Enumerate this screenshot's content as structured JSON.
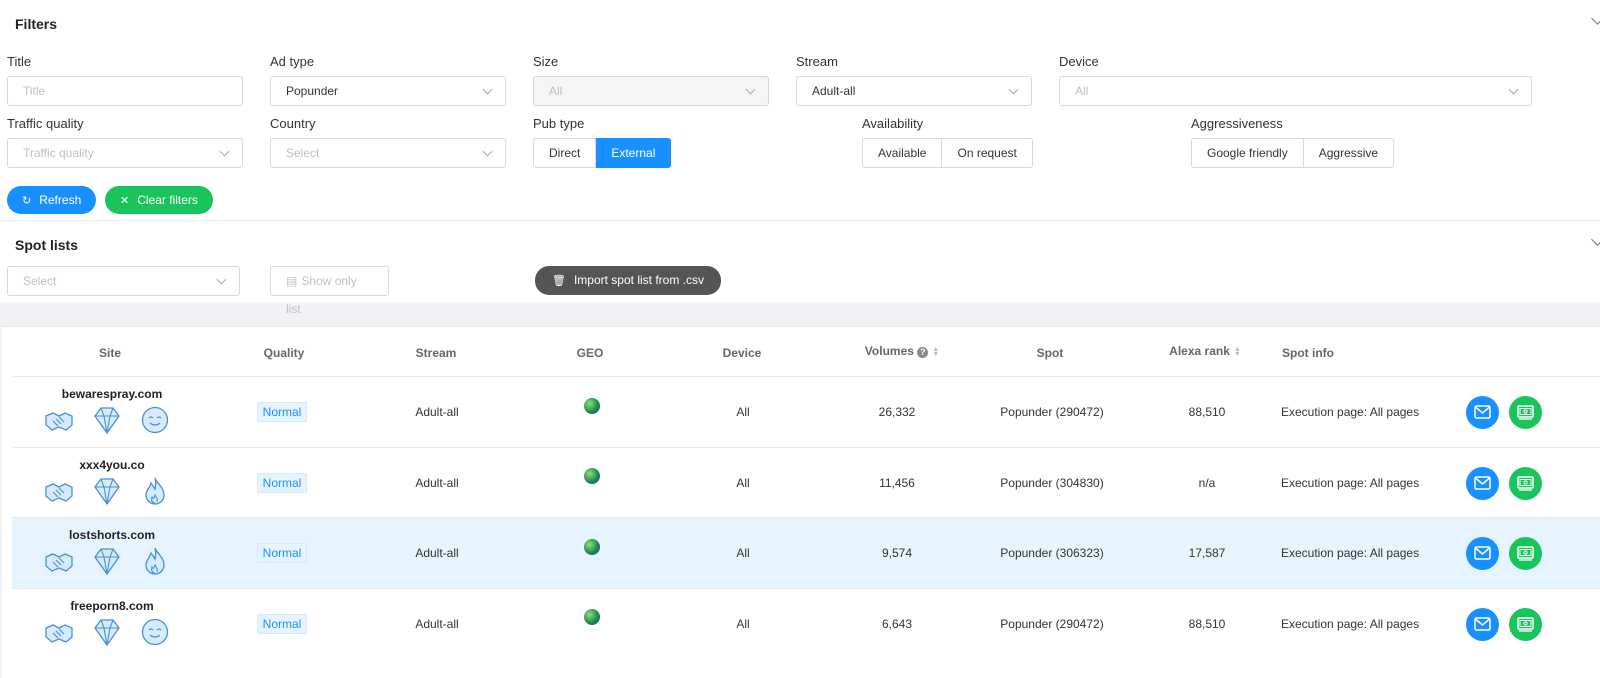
{
  "filters": {
    "title": "Filters",
    "title_label": "Title",
    "title_placeholder": "Title",
    "ad_type_label": "Ad type",
    "ad_type_value": "Popunder",
    "size_label": "Size",
    "size_value": "All",
    "stream_label": "Stream",
    "stream_value": "Adult-all",
    "device_label": "Device",
    "device_value": "All",
    "traffic_quality_label": "Traffic quality",
    "traffic_quality_placeholder": "Traffic quality",
    "country_label": "Country",
    "country_placeholder": "Select",
    "pub_type_label": "Pub type",
    "pub_type_options": [
      "Direct",
      "External"
    ],
    "pub_type_selected": "External",
    "availability_label": "Availability",
    "availability_options": [
      "Available",
      "On request"
    ],
    "aggressiveness_label": "Aggressiveness",
    "aggressiveness_options": [
      "Google friendly",
      "Aggressive"
    ],
    "refresh_label": "Refresh",
    "clear_label": "Clear filters"
  },
  "spot_lists": {
    "title": "Spot lists",
    "select_placeholder": "Select",
    "show_only_label": "Show only list",
    "import_label": "Import spot list from .csv"
  },
  "table": {
    "headers": {
      "site": "Site",
      "quality": "Quality",
      "stream": "Stream",
      "geo": "GEO",
      "device": "Device",
      "volumes": "Volumes",
      "spot": "Spot",
      "alexa": "Alexa rank",
      "spot_info": "Spot info"
    },
    "rows": [
      {
        "site": "bewarespray.com",
        "quality": "Normal",
        "stream": "Adult-all",
        "device": "All",
        "volumes": "26,332",
        "spot": "Popunder (290472)",
        "alexa": "88,510",
        "info": "Execution page: All pages",
        "third_icon": "smile-icon"
      },
      {
        "site": "xxx4you.co",
        "quality": "Normal",
        "stream": "Adult-all",
        "device": "All",
        "volumes": "11,456",
        "spot": "Popunder (304830)",
        "alexa": "n/a",
        "info": "Execution page: All pages",
        "third_icon": "fire-icon"
      },
      {
        "site": "lostshorts.com",
        "quality": "Normal",
        "stream": "Adult-all",
        "device": "All",
        "volumes": "9,574",
        "spot": "Popunder (306323)",
        "alexa": "17,587",
        "info": "Execution page: All pages",
        "third_icon": "fire-icon"
      },
      {
        "site": "freeporn8.com",
        "quality": "Normal",
        "stream": "Adult-all",
        "device": "All",
        "volumes": "6,643",
        "spot": "Popunder (290472)",
        "alexa": "88,510",
        "info": "Execution page: All pages",
        "third_icon": "smile-icon"
      }
    ]
  },
  "colors": {
    "primary": "#1890ff",
    "success": "#19c45a",
    "dark": "#555555",
    "highlight_row": "#e6f4ff"
  }
}
